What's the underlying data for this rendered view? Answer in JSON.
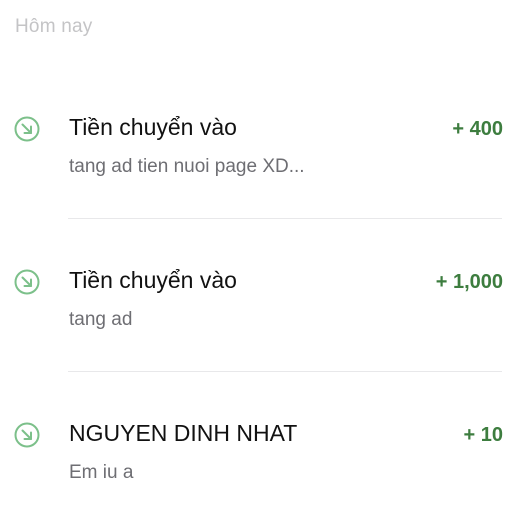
{
  "section": {
    "header": "Hôm nay"
  },
  "colors": {
    "positive": "#3d7d3f",
    "icon": "#7cc08a"
  },
  "transactions": [
    {
      "icon": "arrow-down-right-circle-icon",
      "title": "Tiền chuyển vào",
      "amount": "+ 400",
      "description": "tang ad tien nuoi page XD..."
    },
    {
      "icon": "arrow-down-right-circle-icon",
      "title": "Tiền chuyển vào",
      "amount": "+ 1,000",
      "description": "tang ad"
    },
    {
      "icon": "arrow-down-right-circle-icon",
      "title": "NGUYEN DINH NHAT",
      "amount": "+ 10",
      "description": "Em iu a"
    }
  ]
}
